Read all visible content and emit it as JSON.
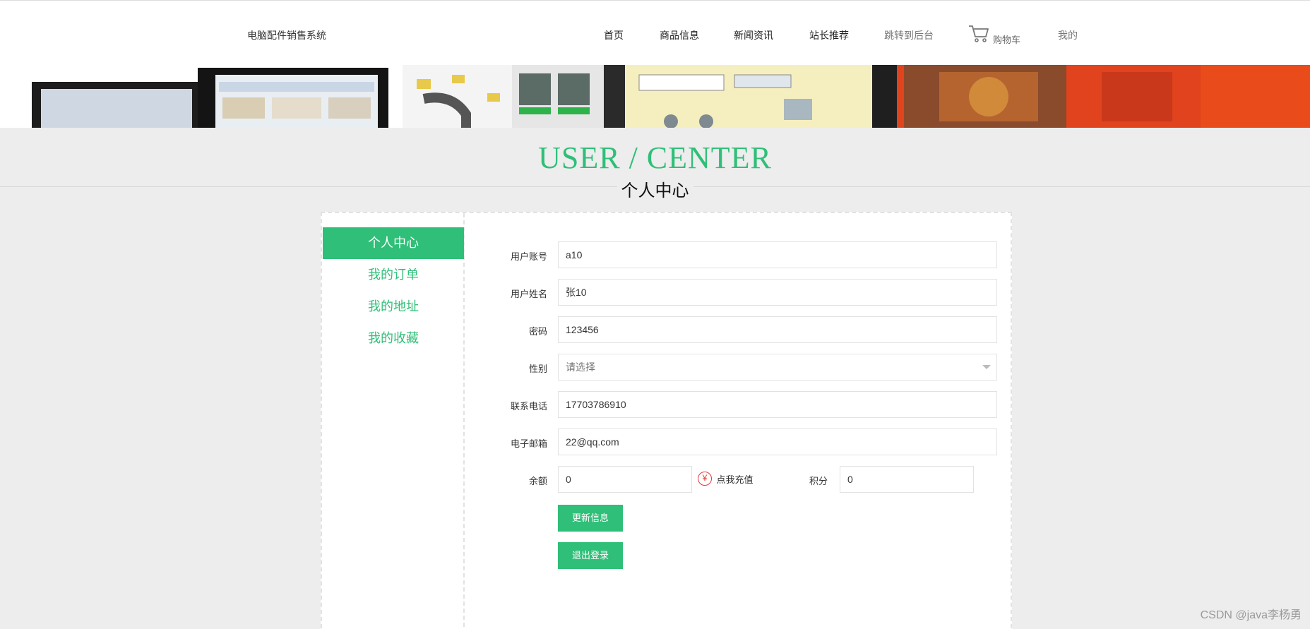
{
  "header": {
    "site_title": "电脑配件销售系统",
    "nav": [
      {
        "label": "首页"
      },
      {
        "label": "商品信息"
      },
      {
        "label": "新闻资讯"
      },
      {
        "label": "站长推荐"
      },
      {
        "label": "跳转到后台"
      }
    ],
    "cart_label": "购物车",
    "mine_label": "我的"
  },
  "hero": {
    "title": "USER / CENTER",
    "subtitle": "个人中心"
  },
  "sidebar": {
    "items": [
      {
        "label": "个人中心"
      },
      {
        "label": "我的订单"
      },
      {
        "label": "我的地址"
      },
      {
        "label": "我的收藏"
      }
    ]
  },
  "form": {
    "account": {
      "label": "用户账号",
      "value": "a10"
    },
    "name": {
      "label": "用户姓名",
      "value": "张10"
    },
    "password": {
      "label": "密码",
      "value": "123456"
    },
    "gender": {
      "label": "性别",
      "placeholder": "请选择"
    },
    "phone": {
      "label": "联系电话",
      "value": "17703786910"
    },
    "email": {
      "label": "电子邮箱",
      "value": "22@qq.com"
    },
    "balance": {
      "label": "余额",
      "value": "0"
    },
    "recharge_label": "点我充值",
    "recharge_icon": "¥",
    "points": {
      "label": "积分",
      "value": "0"
    },
    "update_button": "更新信息",
    "logout_button": "退出登录"
  },
  "watermark": "CSDN @java李杨勇",
  "colors": {
    "accent": "#2fbf78",
    "page_bg": "#ededed",
    "recharge_icon": "#e33333"
  }
}
